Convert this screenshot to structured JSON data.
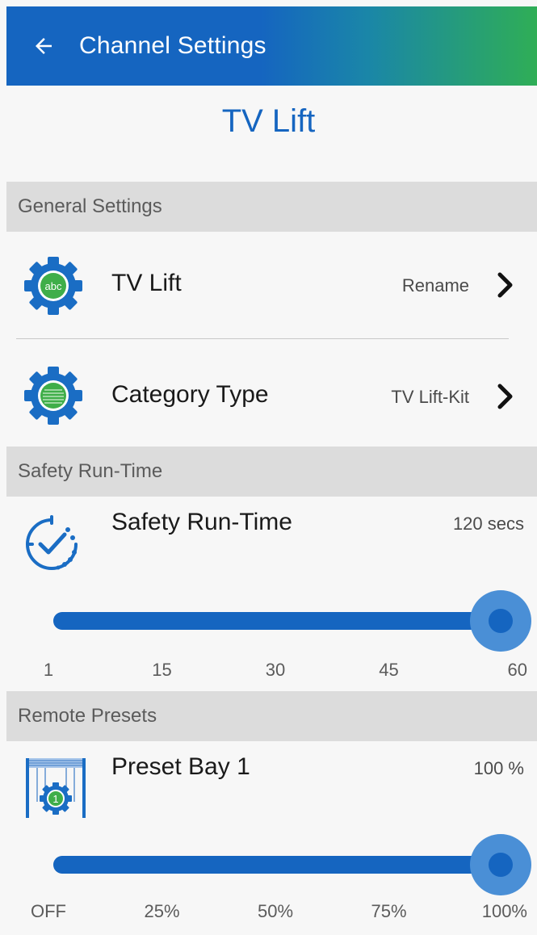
{
  "appbar": {
    "title": "Channel Settings",
    "back_icon": "arrow-left-icon"
  },
  "channel": {
    "name": "TV Lift"
  },
  "sections": {
    "general": "General Settings",
    "safety": "Safety Run-Time",
    "remote": "Remote Presets"
  },
  "general_rows": [
    {
      "label": "TV Lift",
      "value": "Rename",
      "icon": "gear-abc-icon"
    },
    {
      "label": "Category Type",
      "value": "TV Lift-Kit",
      "icon": "gear-category-icon"
    }
  ],
  "safety_runtime": {
    "label": "Safety Run-Time",
    "readout": "120 secs",
    "icon": "clock-check-icon",
    "slider_fraction": 1.0,
    "ticks": [
      "1",
      "15",
      "30",
      "45",
      "60"
    ]
  },
  "preset_bay": {
    "label": "Preset Bay 1",
    "readout": "100 %",
    "icon": "bay-gear-icon",
    "slider_fraction": 1.0,
    "ticks": [
      "OFF",
      "25%",
      "50%",
      "75%",
      "100%"
    ]
  },
  "colors": {
    "primary": "#1565c0",
    "gradient_end": "#2fae56",
    "section_bg": "#dcdcdc",
    "icon_green": "#3fae49"
  }
}
